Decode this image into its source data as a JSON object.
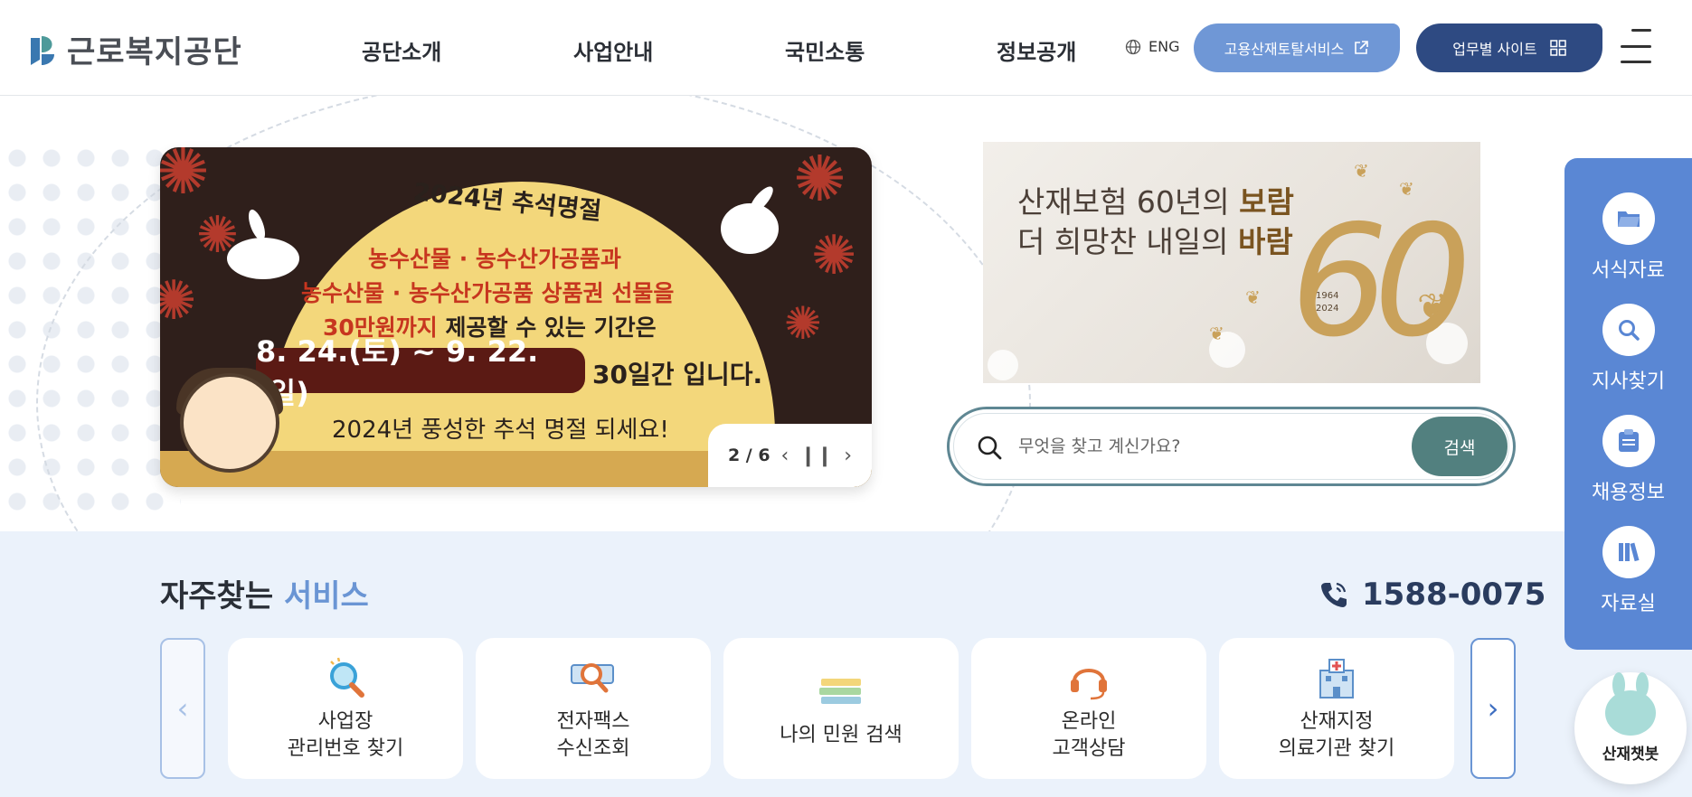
{
  "header": {
    "logo_text": "근로복지공단",
    "nav": [
      "공단소개",
      "사업안내",
      "국민소통",
      "정보공개"
    ],
    "lang": "ENG",
    "portal_button": "고용산재토탈서비스",
    "biz_button": "업무별 사이트"
  },
  "banner": {
    "title": "2024년 추석명절",
    "line1": "농수산물 · 농수산가공품과",
    "line2": "농수산물 · 농수산가공품 상품권 선물을",
    "line3_highlight": "30만원까지",
    "line3_rest": " 제공할 수 있는 기간은",
    "date": "8. 24.(토) ~ 9. 22.(일)",
    "date_tail": "30일간 입니다.",
    "closing": "2024년 풍성한 추석 명절 되세요!",
    "pager_text": "2 / 6",
    "prev_icon": "chevron-left",
    "pause_icon": "pause",
    "next_icon": "chevron-right"
  },
  "promo": {
    "line1_plain": "산재보험 60년의 ",
    "line1_bold": "보람",
    "line2_plain": "더 희망찬 내일의 ",
    "line2_bold": "바람",
    "big_number": "60",
    "badge_top": "1964",
    "badge_bottom": "2024"
  },
  "search": {
    "placeholder": "무엇을 찾고 계신가요?",
    "button": "검색"
  },
  "quick": {
    "title_plain": "자주찾는 ",
    "title_accent": "서비스",
    "phone": "1588-0075",
    "items": [
      {
        "line1": "사업장",
        "line2": "관리번호 찾기",
        "icon": "magnifier-icon"
      },
      {
        "line1": "전자팩스",
        "line2": "수신조회",
        "icon": "fax-search-icon"
      },
      {
        "line1": "나의 민원 검색",
        "line2": "",
        "icon": "books-icon"
      },
      {
        "line1": "온라인",
        "line2": "고객상담",
        "icon": "headset-icon"
      },
      {
        "line1": "산재지정",
        "line2": "의료기관 찾기",
        "icon": "hospital-icon"
      }
    ]
  },
  "sidebar": {
    "items": [
      {
        "label": "서식자료",
        "icon": "folder-icon"
      },
      {
        "label": "지사찾기",
        "icon": "search-icon"
      },
      {
        "label": "채용정보",
        "icon": "clipboard-icon"
      },
      {
        "label": "자료실",
        "icon": "library-icon"
      }
    ]
  },
  "chatbot": {
    "label": "산재챗봇"
  },
  "colors": {
    "primary": "#5a87d4",
    "navy": "#2e4a82",
    "teal": "#52807f",
    "quick_bg": "#ebf2fb"
  }
}
